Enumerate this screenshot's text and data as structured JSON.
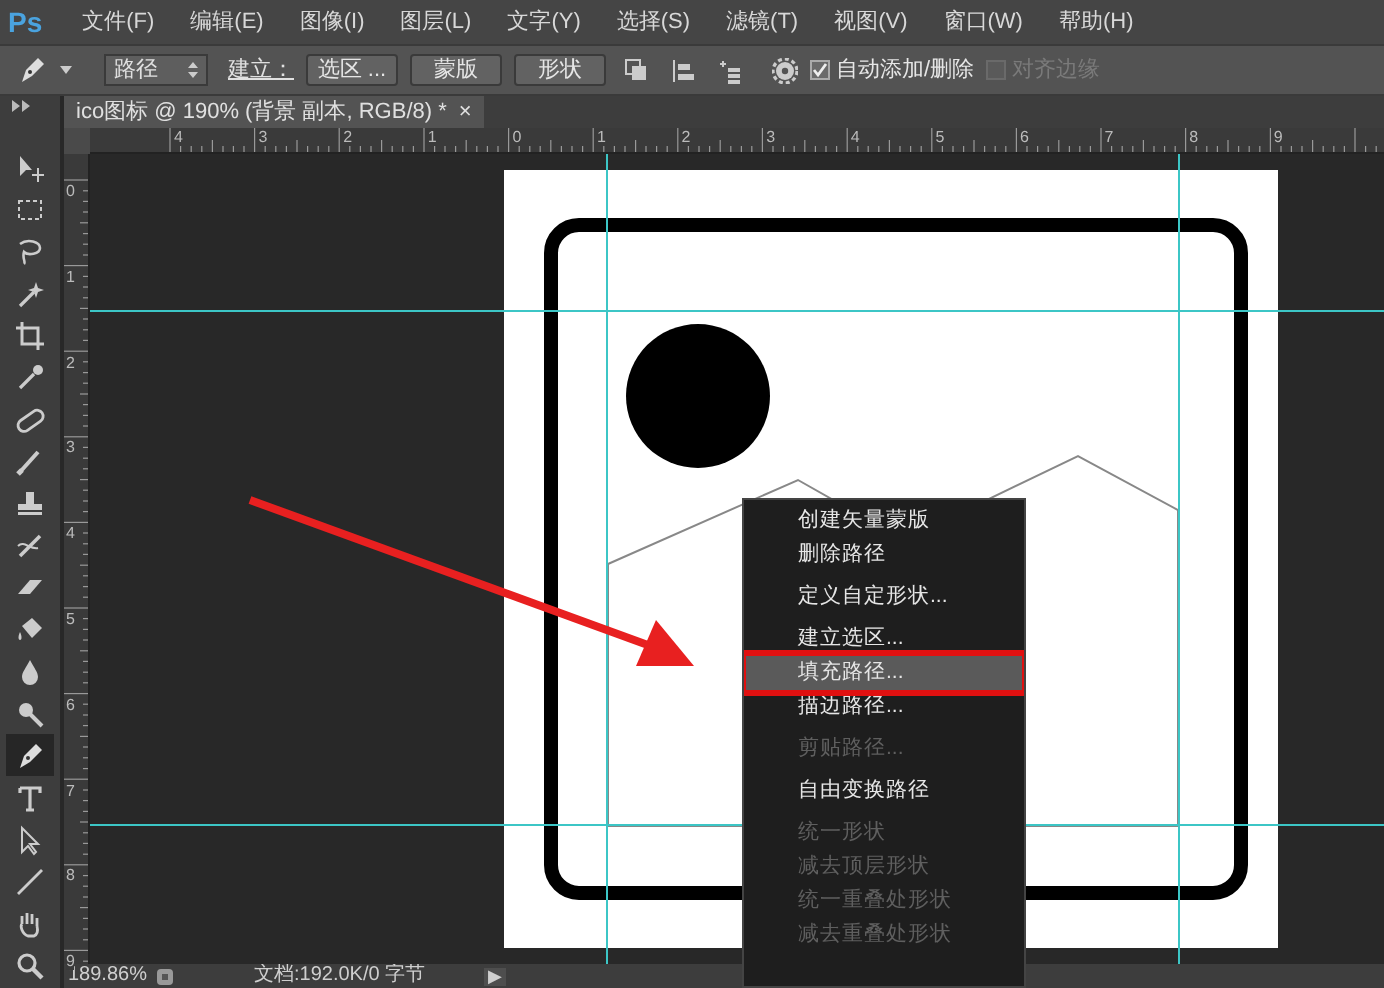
{
  "menu_bar": {
    "logo": "Ps",
    "items": [
      "文件(F)",
      "编辑(E)",
      "图像(I)",
      "图层(L)",
      "文字(Y)",
      "选择(S)",
      "滤镜(T)",
      "视图(V)",
      "窗口(W)",
      "帮助(H)"
    ]
  },
  "options_bar": {
    "mode": "路径",
    "make_label": "建立：",
    "buttons": [
      "选区 ...",
      "蒙版",
      "形状"
    ],
    "checkboxes": [
      {
        "label": "自动添加/删除",
        "checked": true,
        "disabled": false
      },
      {
        "label": "对齐边缘",
        "checked": false,
        "disabled": true
      }
    ]
  },
  "tools": [
    {
      "kind": "move",
      "selected": false
    },
    {
      "kind": "marquee",
      "selected": false
    },
    {
      "kind": "lasso",
      "selected": false
    },
    {
      "kind": "wand",
      "selected": false
    },
    {
      "kind": "crop",
      "selected": false
    },
    {
      "kind": "eyedropper",
      "selected": false
    },
    {
      "kind": "healing",
      "selected": false
    },
    {
      "kind": "brush",
      "selected": false
    },
    {
      "kind": "stamp",
      "selected": false
    },
    {
      "kind": "history",
      "selected": false
    },
    {
      "kind": "eraser",
      "selected": false
    },
    {
      "kind": "bucket",
      "selected": false
    },
    {
      "kind": "blur",
      "selected": false
    },
    {
      "kind": "dodge",
      "selected": false
    },
    {
      "kind": "pen",
      "selected": true
    },
    {
      "kind": "type",
      "selected": false
    },
    {
      "kind": "path_select",
      "selected": false
    },
    {
      "kind": "line",
      "selected": false
    },
    {
      "kind": "hand",
      "selected": false
    },
    {
      "kind": "zoom",
      "selected": false
    }
  ],
  "document_tab": {
    "title": "ico图标 @ 190% (背景 副本, RGB/8) *",
    "close": "×"
  },
  "rulers": {
    "horizontal": [
      "4",
      "3",
      "2",
      "1",
      "0",
      "1",
      "2",
      "3",
      "4",
      "5",
      "6",
      "7",
      "8",
      "9"
    ],
    "vertical": [
      "0",
      "1",
      "2",
      "3",
      "4",
      "5",
      "6",
      "7",
      "8",
      "9"
    ]
  },
  "context_menu": {
    "items": [
      {
        "kind": "item",
        "label": "创建矢量蒙版",
        "disabled": false,
        "selected": false
      },
      {
        "kind": "item",
        "label": "删除路径",
        "disabled": false,
        "selected": false
      },
      {
        "kind": "separator"
      },
      {
        "kind": "item",
        "label": "定义自定形状...",
        "disabled": false,
        "selected": false
      },
      {
        "kind": "separator"
      },
      {
        "kind": "item",
        "label": "建立选区...",
        "disabled": false,
        "selected": false
      },
      {
        "kind": "item",
        "label": "填充路径...",
        "disabled": false,
        "selected": true
      },
      {
        "kind": "item",
        "label": "描边路径...",
        "disabled": false,
        "selected": false
      },
      {
        "kind": "separator"
      },
      {
        "kind": "item",
        "label": "剪贴路径...",
        "disabled": true,
        "selected": false
      },
      {
        "kind": "separator"
      },
      {
        "kind": "item",
        "label": "自由变换路径",
        "disabled": false,
        "selected": false
      },
      {
        "kind": "separator"
      },
      {
        "kind": "item",
        "label": "统一形状",
        "disabled": true,
        "selected": false
      },
      {
        "kind": "item",
        "label": "减去顶层形状",
        "disabled": true,
        "selected": false
      },
      {
        "kind": "item",
        "label": "统一重叠处形状",
        "disabled": true,
        "selected": false
      },
      {
        "kind": "item",
        "label": "减去重叠处形状",
        "disabled": true,
        "selected": false
      }
    ]
  },
  "status_bar": {
    "zoom": "189.86%",
    "doc_info": "文档:192.0K/0 字节",
    "arrow": "▶"
  }
}
